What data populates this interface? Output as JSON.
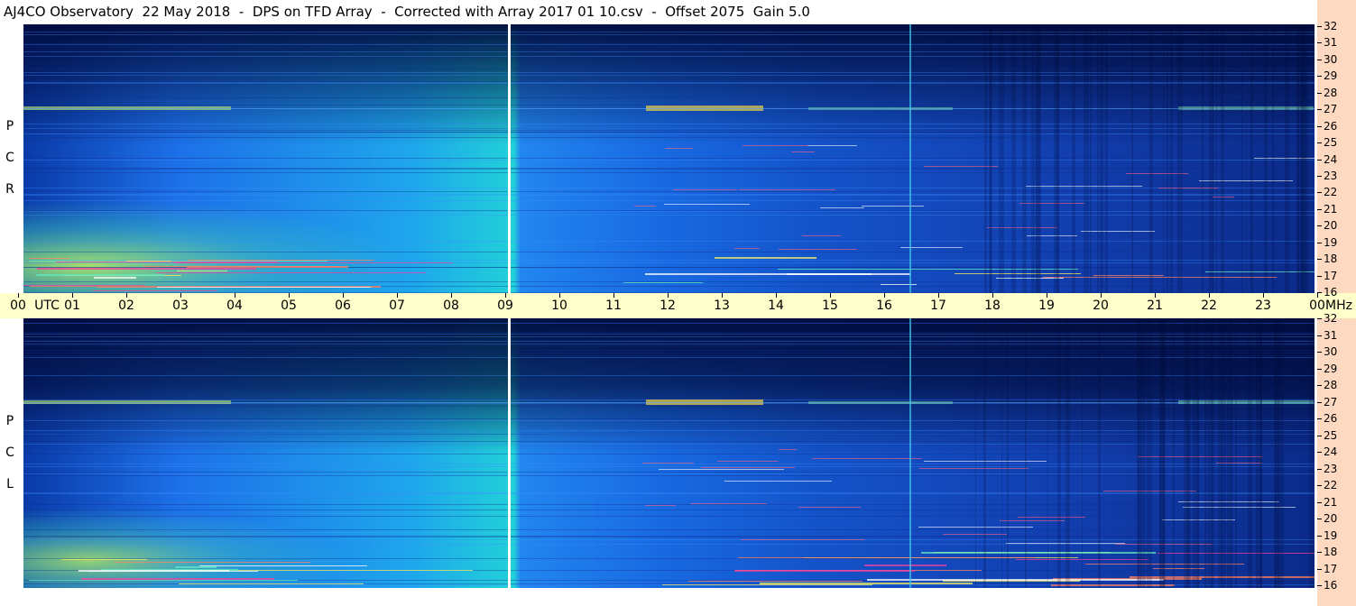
{
  "header": {
    "title": "AJ4CO Observatory  22 May 2018  -  DPS on TFD Array  -  Corrected with Array 2017 01 10.csv  -  Offset 2075  Gain 5.0"
  },
  "panels": {
    "top_label": [
      "R",
      "C",
      "P"
    ],
    "bottom_label": [
      "L",
      "C",
      "P"
    ]
  },
  "time_axis": {
    "labels": [
      "00",
      "01",
      "02",
      "03",
      "04",
      "05",
      "06",
      "07",
      "08",
      "09",
      "10",
      "11",
      "12",
      "13",
      "14",
      "15",
      "16",
      "17",
      "18",
      "19",
      "20",
      "21",
      "22",
      "23",
      "00"
    ],
    "utc_label": "UTC",
    "mhz_label": "MHz"
  },
  "colors": {
    "background_frame": "#fcd9c0",
    "axis_band": "#ffffcc",
    "palette_low": "#000830",
    "palette_mid": "#1a60e0",
    "palette_high": "#20d0c0",
    "palette_hot": "#f0f060"
  },
  "chart_data": [
    {
      "type": "heatmap",
      "title": "RCP",
      "xlabel": "UTC",
      "ylabel": "MHz",
      "x_range": [
        "00",
        "00"
      ],
      "y_range": [
        16,
        32
      ],
      "y_ticks": [
        16,
        17,
        18,
        19,
        20,
        21,
        22,
        23,
        24,
        25,
        26,
        27,
        28,
        29,
        30,
        31,
        32
      ],
      "gap_marker_utc": "09",
      "notes": "Dynamic spectrum; strong emission lines near 27 MHz and 16-18 MHz"
    },
    {
      "type": "heatmap",
      "title": "LCP",
      "xlabel": "UTC",
      "ylabel": "MHz",
      "x_range": [
        "00",
        "00"
      ],
      "y_range": [
        16,
        32
      ],
      "y_ticks": [
        16,
        17,
        18,
        19,
        20,
        21,
        22,
        23,
        24,
        25,
        26,
        27,
        28,
        29,
        30,
        31,
        32
      ],
      "gap_marker_utc": "09",
      "notes": "Dynamic spectrum; strong emission lines near 27 MHz and 16-18 MHz"
    }
  ]
}
